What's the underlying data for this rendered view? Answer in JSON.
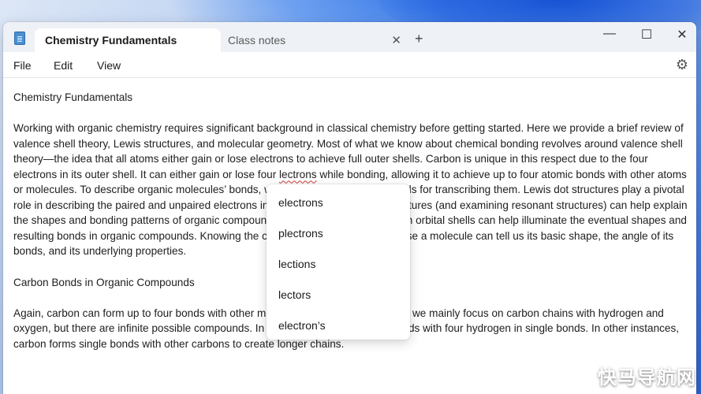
{
  "window": {
    "tabs": [
      {
        "title": "Chemistry Fundamentals",
        "active": true
      },
      {
        "title": "Class notes",
        "active": false
      }
    ],
    "close_tab_glyph": "✕",
    "new_tab_glyph": "+",
    "controls": {
      "minimize": "—",
      "maximize": "☐",
      "close": "✕"
    }
  },
  "menu": {
    "items": [
      "File",
      "Edit",
      "View"
    ],
    "settings_icon": "gear-icon"
  },
  "document": {
    "heading1": "Chemistry Fundamentals",
    "p1": {
      "before": "Working with organic chemistry requires significant background in classical chemistry before getting started. Here we provide a brief review of valence shell theory, Lewis structures, and molecular geometry. Most of what we know about chemical bonding revolves around valence shell theory—the idea that all atoms either gain or lose electrons to achieve full outer shells. Carbon is unique in this respect due to the four electrons in its outer shell. It can either gain or lose four ",
      "misspelled": "lectrons",
      "after": " while bonding, allowing it to achieve up to four atomic bonds with other atoms or molecules. To describe organic molecules’ bonds, we’ll quickly review the methods for transcribing them. Lewis dot structures play a pivotal role in describing the paired and unpaired electrons in atoms. Using Lewis dot structures (and examining resonant structures) can help explain the shapes and bonding patterns of organic compounds. Understanding the electron orbital shells can help illuminate the eventual shapes and resulting bonds in organic compounds. Knowing the chemical elements that comprise a molecule can tell us its basic shape, the angle of its bonds, and its underlying properties."
    },
    "heading2": "Carbon Bonds in Organic Compounds",
    "p2": "Again, carbon can form up to four bonds with other molecules. In organic chemistry, we mainly focus on carbon chains with hydrogen and oxygen, but there are infinite possible compounds. In the simplest form, carbon bonds with four hydrogen in single bonds. In other instances, carbon forms single bonds with other carbons to create longer chains."
  },
  "spellcheck": {
    "suggestions": [
      "electrons",
      "plectrons",
      "lections",
      "lectors",
      "electron’s"
    ]
  },
  "watermark": "快马导航网"
}
